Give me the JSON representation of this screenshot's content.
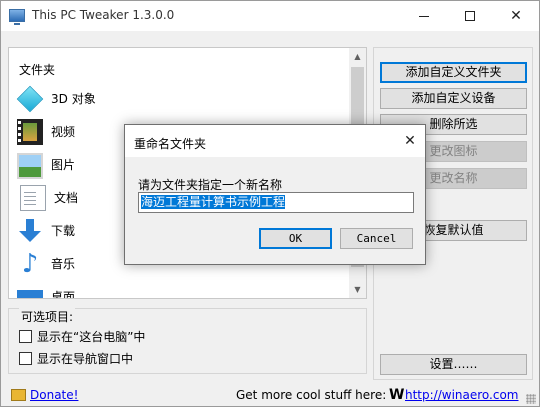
{
  "window": {
    "title": "This PC Tweaker 1.3.0.0",
    "minimize_glyph": "",
    "close_glyph": "✕"
  },
  "folders": {
    "label": "文件夹",
    "items": [
      {
        "icon": "3d-objects-icon",
        "label": "3D 对象"
      },
      {
        "icon": "video-icon",
        "label": "视频"
      },
      {
        "icon": "pictures-icon",
        "label": "图片"
      },
      {
        "icon": "documents-icon",
        "label": "文档"
      },
      {
        "icon": "downloads-icon",
        "label": "下载"
      },
      {
        "icon": "music-icon",
        "label": "音乐"
      },
      {
        "icon": "desktop-icon",
        "label": "桌面"
      }
    ],
    "scroll_up": "▲",
    "scroll_down": "▼"
  },
  "options": {
    "title": "可选项目:",
    "items": [
      {
        "label": "显示在“这台电脑”中",
        "checked": false
      },
      {
        "label": "显示在导航窗口中",
        "checked": false
      }
    ]
  },
  "buttons": {
    "add_folder": "添加自定义文件夹",
    "add_device": "添加自定义设备",
    "remove": "删除所选",
    "change_icon": "更改图标",
    "change_name": "更改名称",
    "restore": "恢复默认值",
    "settings": "设置……"
  },
  "footer": {
    "donate": "Donate!",
    "more": "Get more cool stuff here:",
    "w_logo": "W",
    "site": "http://winaero.com"
  },
  "dialog": {
    "title": "重命名文件夹",
    "close_glyph": "✕",
    "prompt": "请为文件夹指定一个新名称",
    "input_value": "海迈工程量计算书示例工程",
    "ok": "OK",
    "cancel": "Cancel"
  },
  "colors": {
    "accent": "#0078d7",
    "link": "#0000ee"
  }
}
